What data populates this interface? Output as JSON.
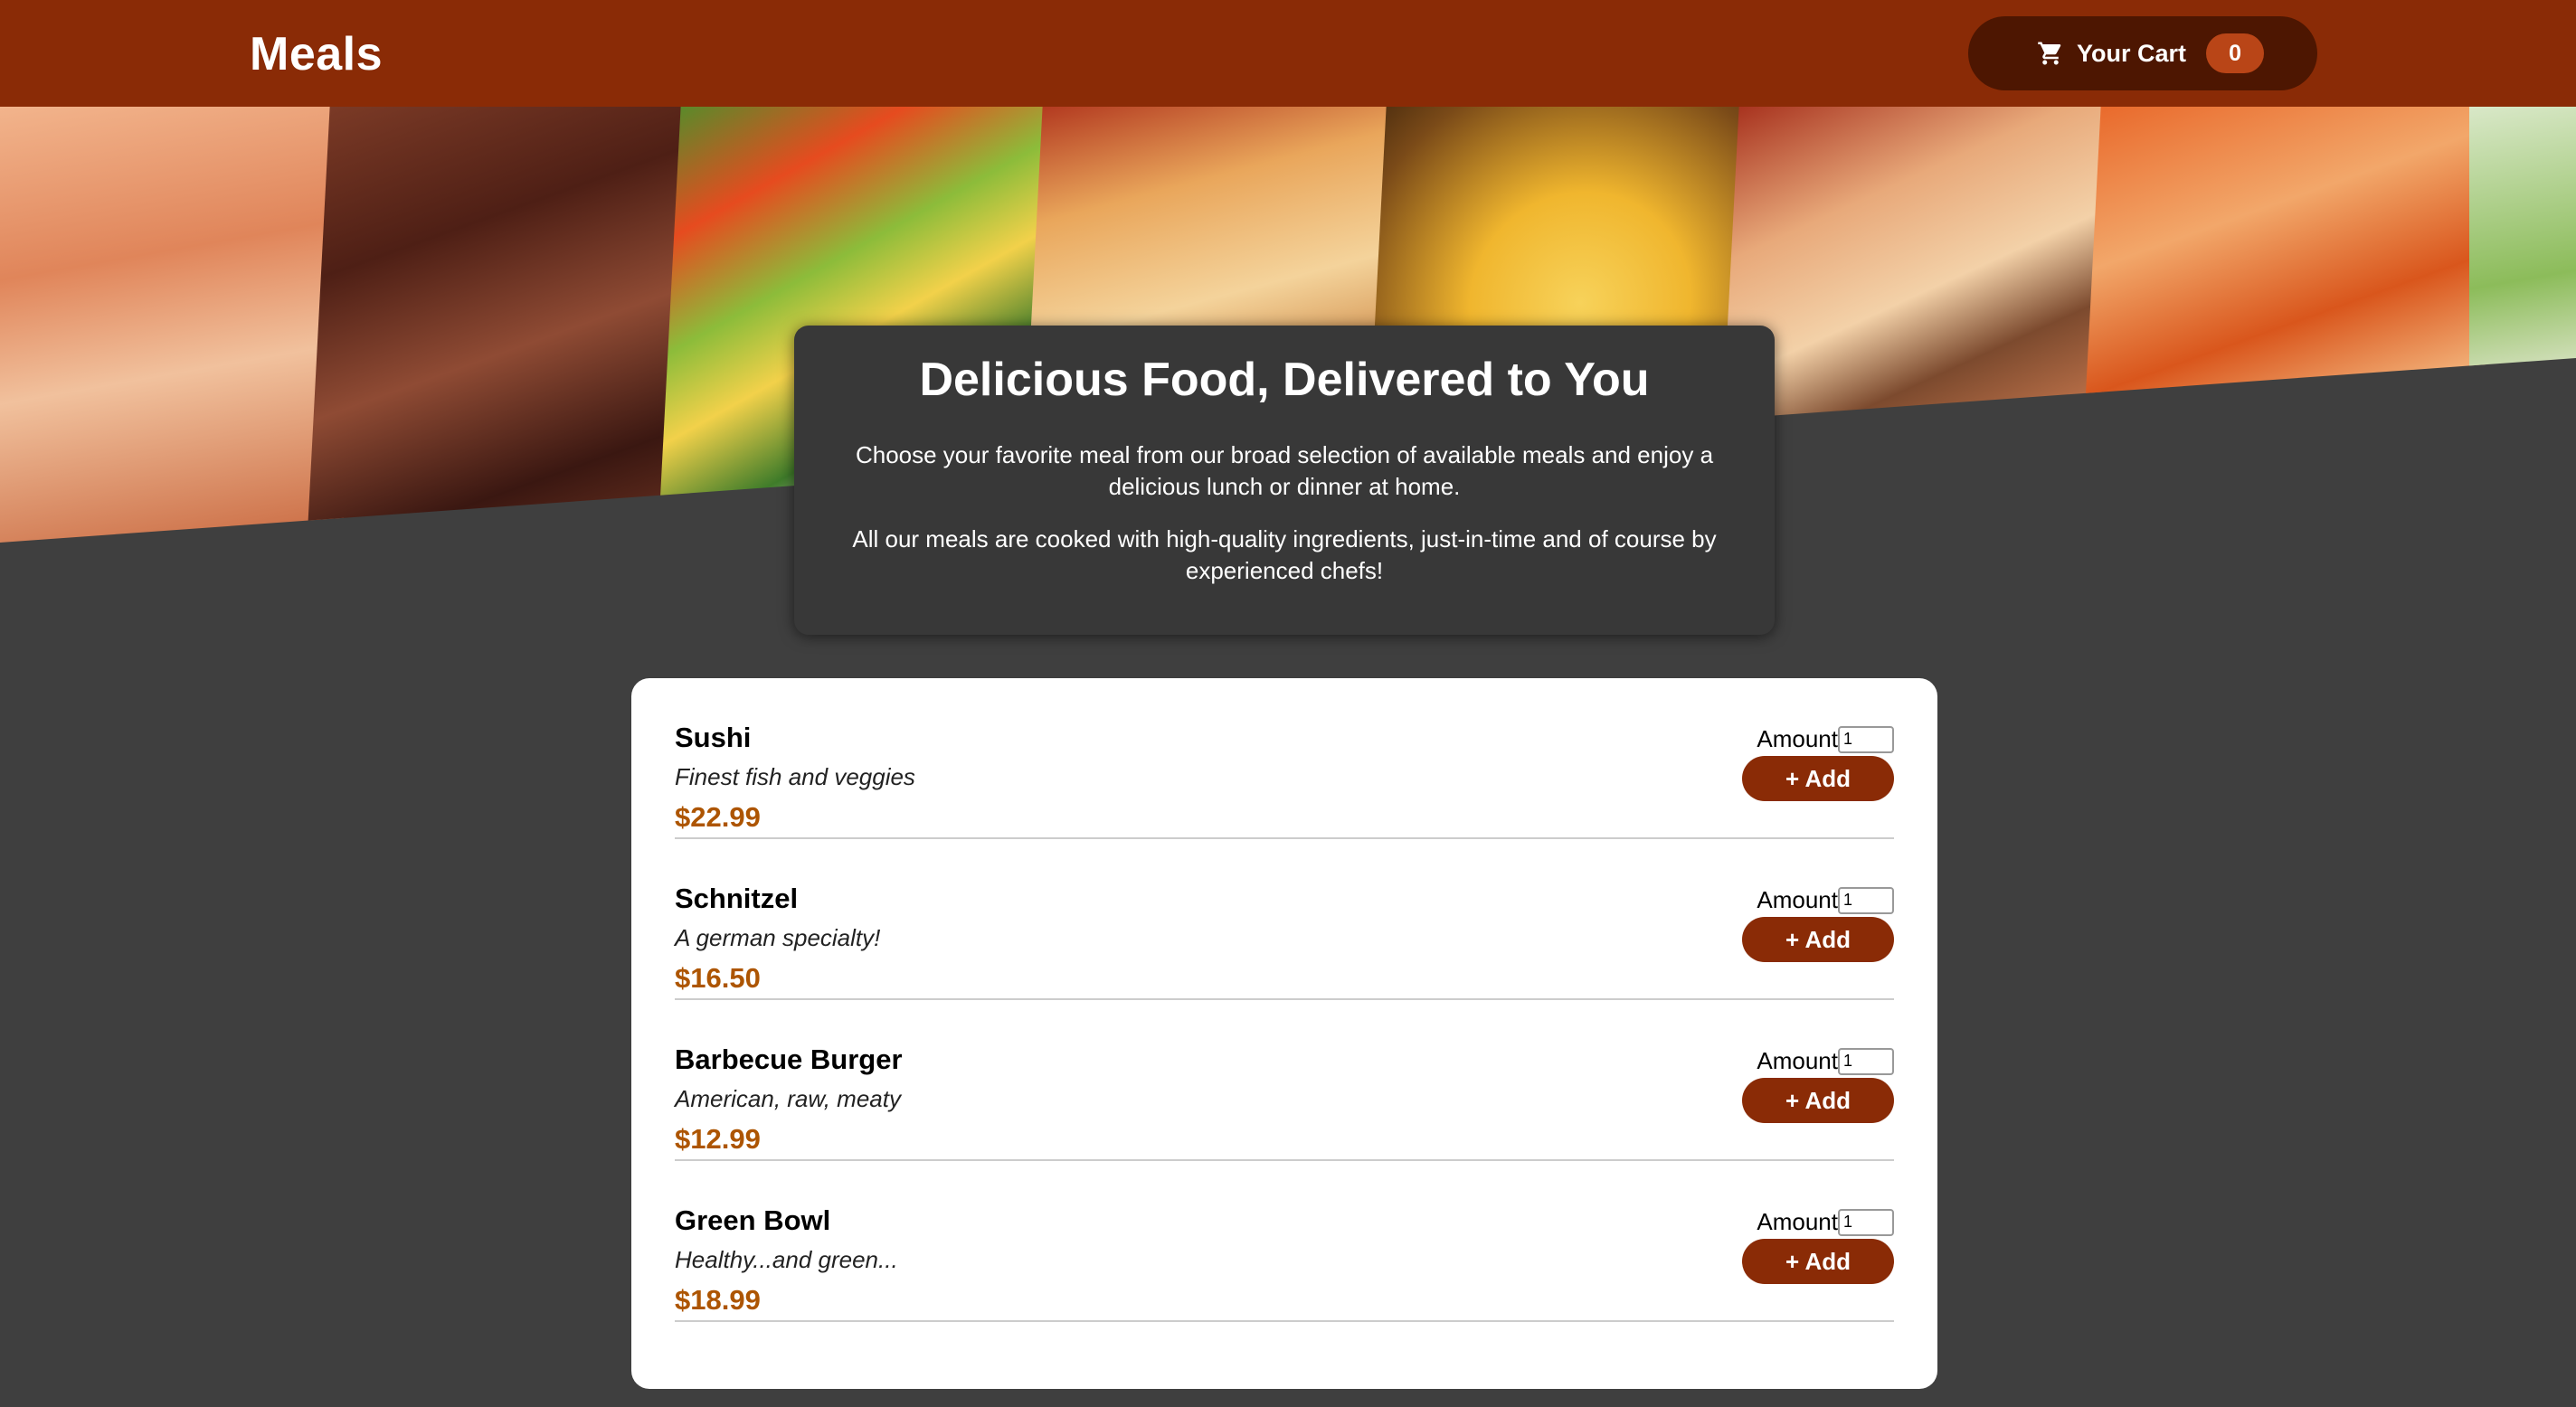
{
  "header": {
    "title": "Meals",
    "cart_label": "Your Cart",
    "cart_count": "0"
  },
  "summary": {
    "heading": "Delicious Food, Delivered to You",
    "paragraph1": "Choose your favorite meal from our broad selection of available meals and enjoy a delicious lunch or dinner at home.",
    "paragraph2": "All our meals are cooked with high-quality ingredients, just-in-time and of course by experienced chefs!"
  },
  "meals": [
    {
      "name": "Sushi",
      "description": "Finest fish and veggies",
      "price": "$22.99",
      "amount_label": "Amount",
      "amount_value": "1",
      "add_label": "+ Add"
    },
    {
      "name": "Schnitzel",
      "description": "A german specialty!",
      "price": "$16.50",
      "amount_label": "Amount",
      "amount_value": "1",
      "add_label": "+ Add"
    },
    {
      "name": "Barbecue Burger",
      "description": "American, raw, meaty",
      "price": "$12.99",
      "amount_label": "Amount",
      "amount_value": "1",
      "add_label": "+ Add"
    },
    {
      "name": "Green Bowl",
      "description": "Healthy...and green...",
      "price": "$18.99",
      "amount_label": "Amount",
      "amount_value": "1",
      "add_label": "+ Add"
    }
  ],
  "colors": {
    "header_bg": "#8a2b06",
    "cart_button_bg": "#4d1601",
    "cart_badge_bg": "#b94517",
    "page_bg": "#3f3f3f",
    "price": "#ad5502"
  },
  "icons": {
    "cart": "shopping-cart-icon"
  }
}
